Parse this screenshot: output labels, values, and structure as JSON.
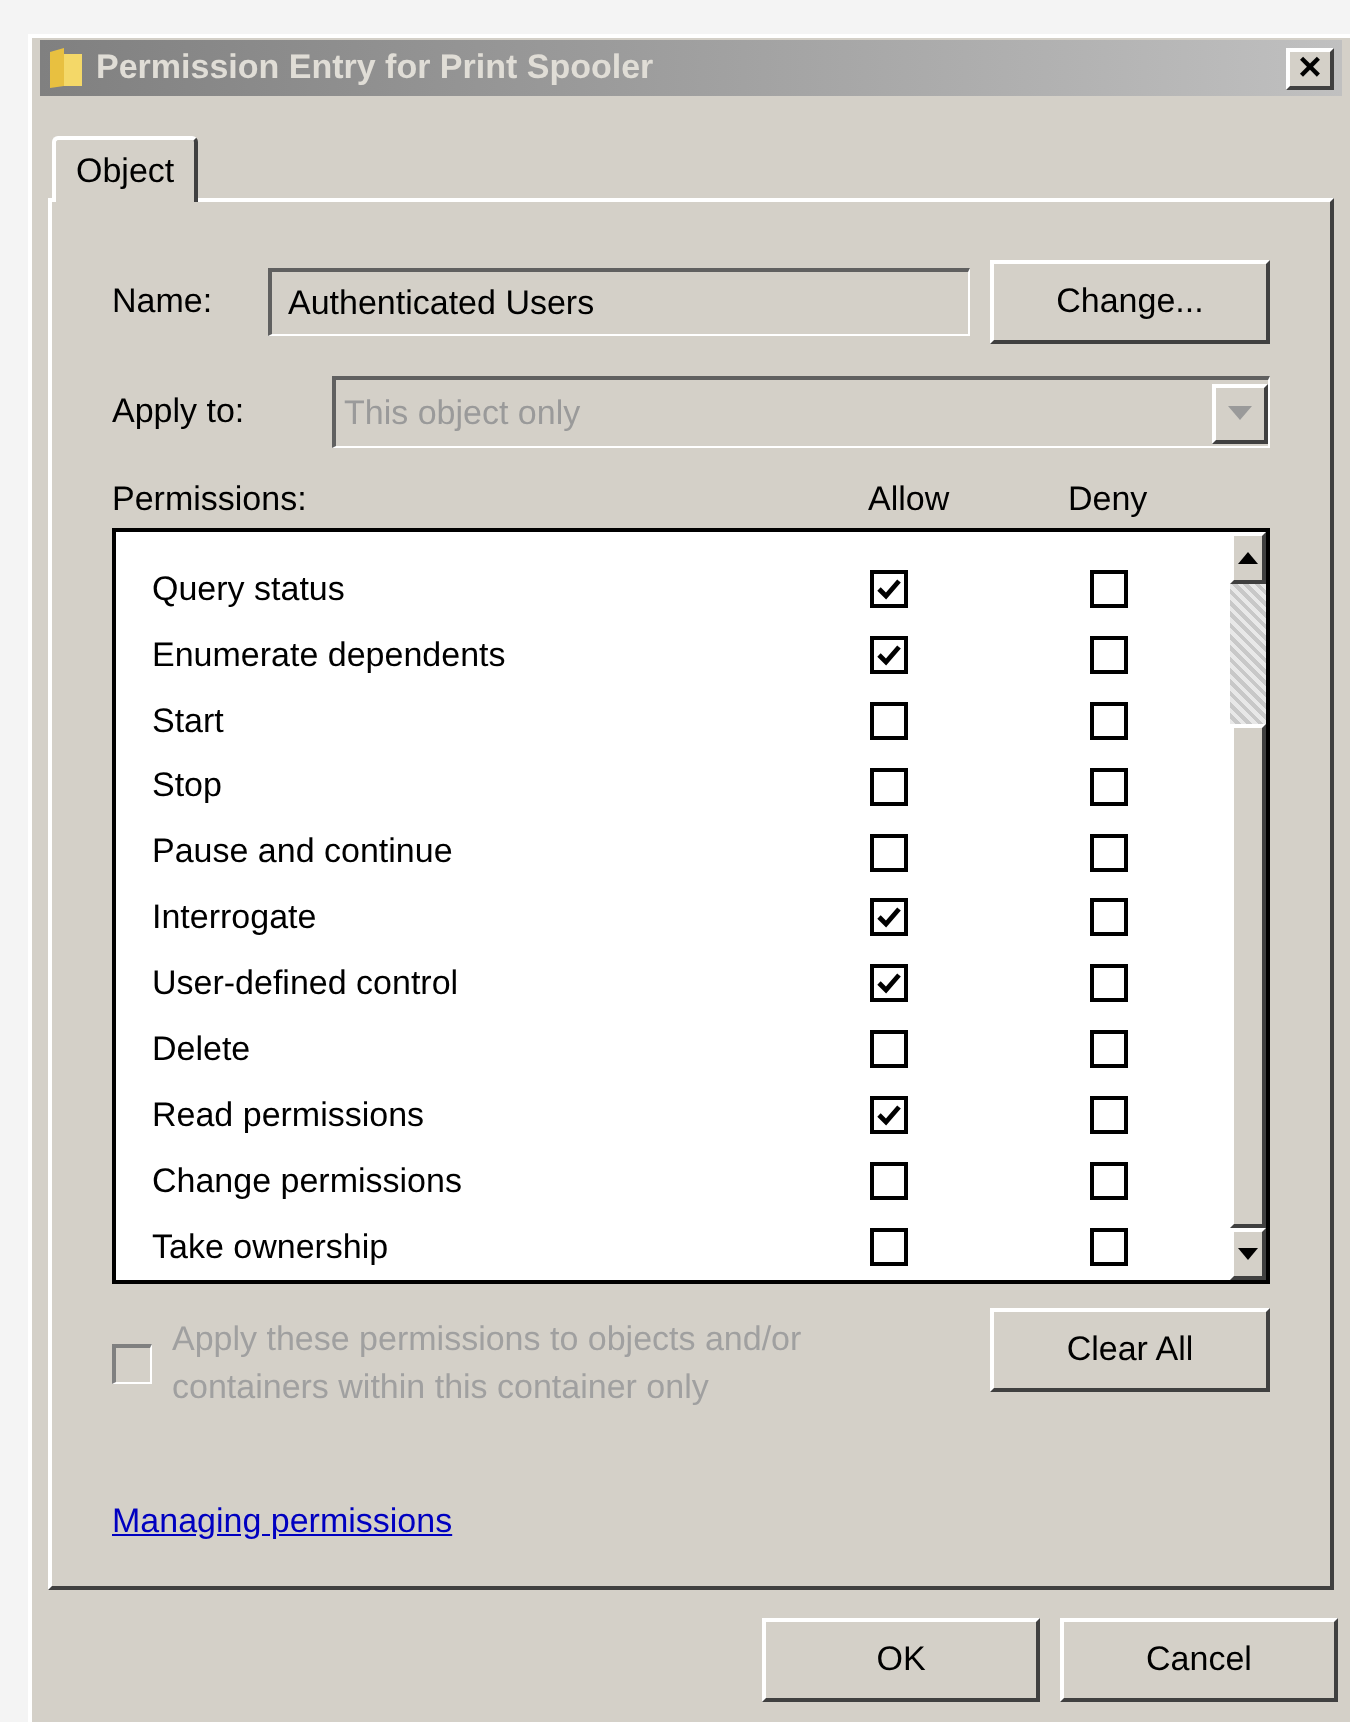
{
  "window": {
    "title": "Permission Entry for Print Spooler",
    "close": "×"
  },
  "tabs": [
    {
      "label": "Object",
      "selected": true
    }
  ],
  "name": {
    "label": "Name:",
    "value": "Authenticated Users",
    "button": "Change..."
  },
  "apply_to": {
    "label": "Apply to:",
    "value": "This object only",
    "disabled": true
  },
  "permissions": {
    "label": "Permissions:",
    "allow_header": "Allow",
    "deny_header": "Deny",
    "rows": [
      {
        "name": "Query status",
        "allow": true,
        "deny": false
      },
      {
        "name": "Enumerate dependents",
        "allow": true,
        "deny": false
      },
      {
        "name": "Start",
        "allow": false,
        "deny": false
      },
      {
        "name": "Stop",
        "allow": false,
        "deny": false
      },
      {
        "name": "Pause and continue",
        "allow": false,
        "deny": false
      },
      {
        "name": "Interrogate",
        "allow": true,
        "deny": false
      },
      {
        "name": "User-defined control",
        "allow": true,
        "deny": false
      },
      {
        "name": "Delete",
        "allow": false,
        "deny": false
      },
      {
        "name": "Read permissions",
        "allow": true,
        "deny": false
      },
      {
        "name": "Change permissions",
        "allow": false,
        "deny": false
      },
      {
        "name": "Take ownership",
        "allow": false,
        "deny": false
      }
    ]
  },
  "apply_inside": {
    "label": "Apply these permissions to objects and/or containers within this container only",
    "checked": false,
    "disabled": true
  },
  "clear_all": "Clear All",
  "link": "Managing permissions",
  "buttons": [
    "OK",
    "Cancel"
  ]
}
